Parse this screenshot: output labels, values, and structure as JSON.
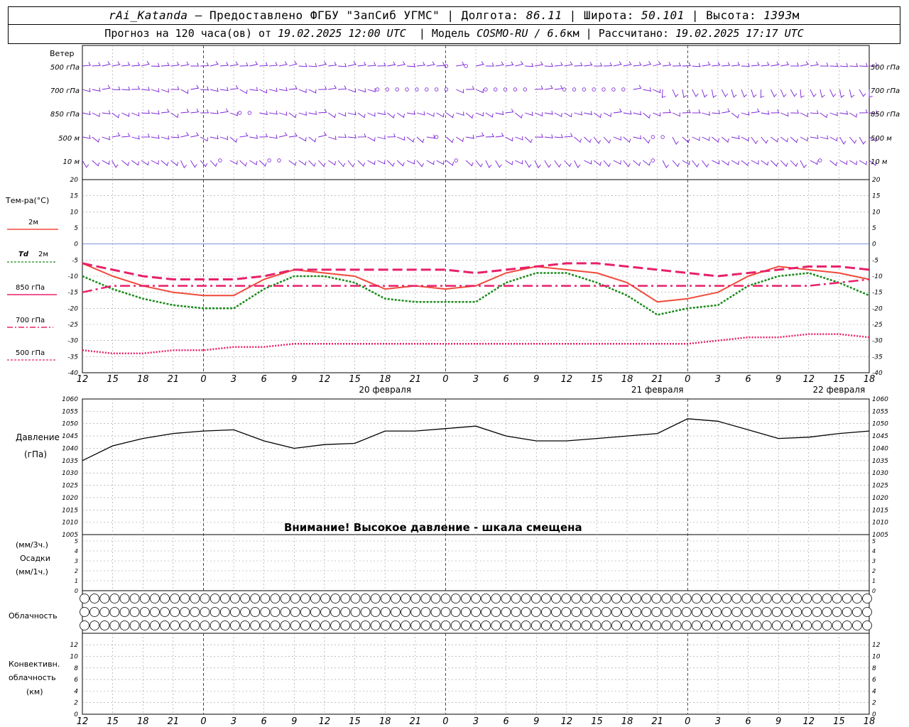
{
  "header": {
    "station": "rAi_Katanda",
    "provider": "— Предоставлено ФГБУ \"ЗапСиб УГМС\"",
    "lon_label": "Долгота:",
    "lon": "86.11",
    "lat_label": "Широта:",
    "lat": "50.101",
    "alt_label": "Высота:",
    "alt": "1393",
    "alt_unit": "м",
    "forecast_label": "Прогноз на 120 часа(ов) от",
    "forecast_time": "19.02.2025 12:00 UTC",
    "model_label": "Модель",
    "model": "COSMO-RU / 6.6",
    "model_unit": "км",
    "computed_label": "Рассчитано:",
    "computed_time": "19.02.2025 17:17 UTC"
  },
  "wind_panel": {
    "title": "Ветер",
    "levels": [
      "500 гПа",
      "700 гПа",
      "850 гПа",
      "500 м",
      "10  м"
    ]
  },
  "legend": {
    "temp_title": "Тем-ра(°C)",
    "t2m": "2м",
    "td2m_td": "Td",
    "td2m": "2м",
    "t850": "850 гПа",
    "t700": "700 гПа",
    "t500": "500 гПа"
  },
  "pressure_panel": {
    "title": "Давление",
    "unit": "(гПа)",
    "warning": "Внимание! Высокое давление - шкала смещена"
  },
  "precip_panel": {
    "unit3": "(мм/3ч.)",
    "title": "Осадки",
    "unit1": "(мм/1ч.)"
  },
  "cloud_panel": {
    "title": "Облачность"
  },
  "conv_panel": {
    "title1": "Конвективн.",
    "title2": "облачность",
    "unit": "(км)"
  },
  "colors": {
    "wind": "#7a1fd6",
    "t2m": "#f04a3a",
    "td2m": "#1a8a1a",
    "t850": "#e8206a",
    "t700": "#e8206a",
    "t500": "#e8206a",
    "zero_line": "#3355cc",
    "pressure": "#000000"
  },
  "chart_data": [
    {
      "type": "line",
      "title": "Тем-ра(°C)",
      "x_label_hours_utc": [
        "12",
        "15",
        "18",
        "21",
        "0",
        "3",
        "6",
        "9",
        "12",
        "15",
        "18",
        "21",
        "0",
        "3",
        "6",
        "9",
        "12",
        "15",
        "18",
        "21",
        "0",
        "3",
        "6",
        "9",
        "12",
        "15",
        "18"
      ],
      "date_labels": [
        "20 февраля",
        "21 февраля",
        "22 февраля"
      ],
      "ylim": [
        -40,
        20
      ],
      "y_ticks": [
        -40,
        -35,
        -30,
        -25,
        -20,
        -15,
        -10,
        -5,
        0,
        5,
        10,
        15,
        20
      ],
      "x_hours_since_start": [
        0,
        3,
        6,
        9,
        12,
        15,
        18,
        21,
        24,
        27,
        30,
        33,
        36,
        39,
        42,
        45,
        48,
        51,
        54,
        57,
        60,
        63,
        66,
        69,
        72,
        75,
        78
      ],
      "series": [
        {
          "name": "2м",
          "key": "t2m",
          "values": [
            -6,
            -10,
            -13,
            -15,
            -16,
            -16,
            -11,
            -8,
            -9,
            -10,
            -14,
            -13,
            -14,
            -13,
            -9,
            -7,
            -8,
            -9,
            -12,
            -18,
            -17,
            -15,
            -10,
            -7,
            -8,
            -9,
            -11
          ]
        },
        {
          "name": "Td 2м",
          "key": "td2m",
          "values": [
            -10,
            -14,
            -17,
            -19,
            -20,
            -20,
            -14,
            -10,
            -10,
            -12,
            -17,
            -18,
            -18,
            -18,
            -12,
            -9,
            -9,
            -12,
            -16,
            -22,
            -20,
            -19,
            -13,
            -10,
            -9,
            -12,
            -16
          ]
        },
        {
          "name": "850 гПа",
          "key": "t850",
          "values": [
            -6,
            -8,
            -10,
            -11,
            -11,
            -11,
            -10,
            -8,
            -8,
            -8,
            -8,
            -8,
            -8,
            -9,
            -8,
            -7,
            -6,
            -6,
            -7,
            -8,
            -9,
            -10,
            -9,
            -8,
            -7,
            -7,
            -8
          ]
        },
        {
          "name": "700 гПа",
          "key": "t700",
          "values": [
            -15,
            -13,
            -13,
            -13,
            -13,
            -13,
            -13,
            -13,
            -13,
            -13,
            -13,
            -13,
            -13,
            -13,
            -13,
            -13,
            -13,
            -13,
            -13,
            -13,
            -13,
            -13,
            -13,
            -13,
            -13,
            -12,
            -11
          ]
        },
        {
          "name": "500 гПа",
          "key": "t500",
          "values": [
            -33,
            -34,
            -34,
            -33,
            -33,
            -32,
            -32,
            -31,
            -31,
            -31,
            -31,
            -31,
            -31,
            -31,
            -31,
            -31,
            -31,
            -31,
            -31,
            -31,
            -31,
            -30,
            -29,
            -29,
            -28,
            -28,
            -29
          ]
        }
      ]
    },
    {
      "type": "line",
      "title": "Давление",
      "ylabel": "(гПа)",
      "ylim": [
        1005,
        1060
      ],
      "y_ticks": [
        1005,
        1010,
        1015,
        1020,
        1025,
        1030,
        1035,
        1040,
        1045,
        1050,
        1055,
        1060
      ],
      "x_hours_since_start": [
        0,
        3,
        6,
        9,
        12,
        15,
        18,
        21,
        24,
        27,
        30,
        33,
        36,
        39,
        42,
        45,
        48,
        51,
        54,
        57,
        60,
        63,
        66,
        69,
        72,
        75,
        78
      ],
      "series": [
        {
          "name": "Давление",
          "values": [
            1035,
            1041,
            1044,
            1046,
            1047,
            1047.5,
            1043,
            1040,
            1041.5,
            1042,
            1047,
            1047,
            1048,
            1049,
            1045,
            1043,
            1043,
            1044,
            1045,
            1046,
            1052,
            1051,
            1047.5,
            1044,
            1044.5,
            1046,
            1047
          ]
        }
      ]
    },
    {
      "type": "bar",
      "title": "Осадки",
      "ylim": [
        0,
        5
      ],
      "y_ticks": [
        0,
        1,
        2,
        3,
        4,
        5
      ],
      "values": []
    },
    {
      "type": "bar",
      "title": "Конвективн. облачность",
      "ylim": [
        0,
        13
      ],
      "y_ticks": [
        0,
        2,
        4,
        6,
        8,
        10,
        12
      ],
      "values": []
    }
  ]
}
